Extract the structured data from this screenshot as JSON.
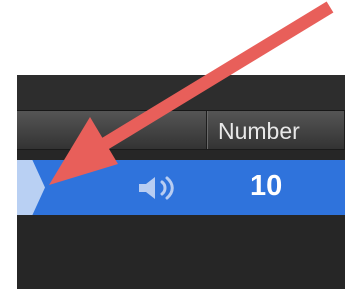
{
  "table": {
    "columns": [
      {
        "label": ""
      },
      {
        "label": "Number"
      }
    ],
    "selected_row": {
      "icon": "speaker-icon",
      "value": "10"
    }
  },
  "annotation": {
    "icon": "annotation-arrow-icon",
    "color": "#e85f5a"
  },
  "colors": {
    "window_background": "#262626",
    "header_background": "#3b3b3b",
    "selected_row_background": "#2f73dc",
    "disclosure_tab": "#b9d0f3"
  }
}
